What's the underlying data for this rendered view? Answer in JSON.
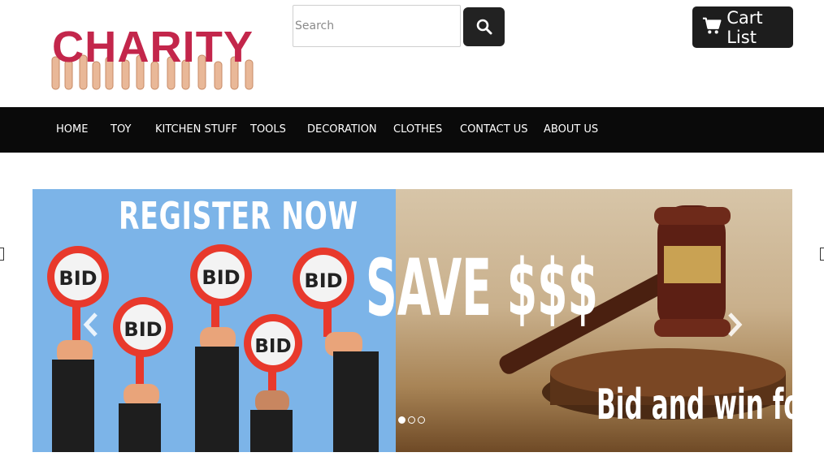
{
  "logo": {
    "text": "CHARITY"
  },
  "search": {
    "placeholder": "Search",
    "button_icon": "search-icon"
  },
  "cart": {
    "label": "Cart List",
    "icon": "cart-icon"
  },
  "nav": {
    "items": [
      {
        "label": "HOME"
      },
      {
        "label": "TOY"
      },
      {
        "label": "KITCHEN STUFF"
      },
      {
        "label": "TOOLS"
      },
      {
        "label": "DECORATION"
      },
      {
        "label": "CLOTHES"
      },
      {
        "label": "CONTACT US"
      },
      {
        "label": "ABOUT US"
      }
    ]
  },
  "carousel": {
    "headline": "REGISTER NOW",
    "paddle_label": "BID",
    "save_text": "SAVE $$$",
    "tagline": "Bid and win for l",
    "slide_count": 3,
    "active_slide": 1,
    "prev_icon": "chevron-left-icon",
    "next_icon": "chevron-right-icon"
  },
  "colors": {
    "brand": "#c3264b",
    "nav_bg": "#0a0a0a",
    "button_bg": "#222222",
    "slide_blue": "#7cb4e8",
    "paddle_red": "#e8392c"
  }
}
